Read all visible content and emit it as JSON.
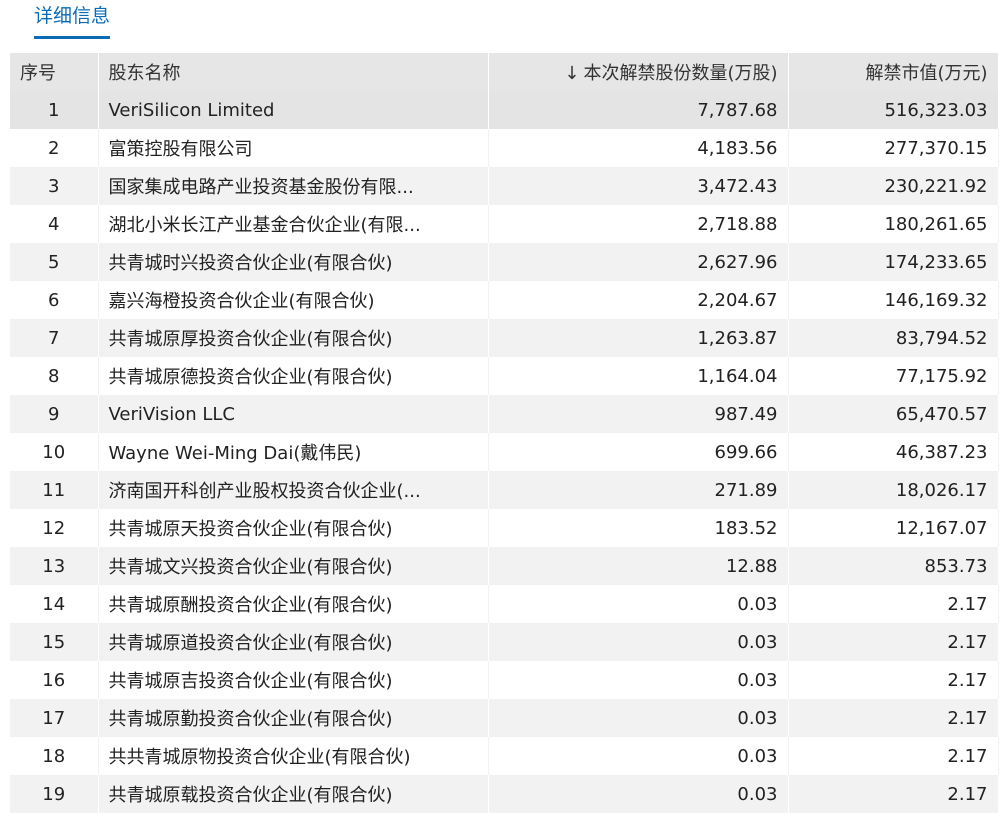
{
  "tabs": {
    "active": "详细信息"
  },
  "table": {
    "headers": {
      "index": "序号",
      "holder": "股东名称",
      "sort_arrow": "↓",
      "shares": "本次解禁股份数量(万股)",
      "value": "解禁市值(万元)"
    },
    "rows": [
      [
        "1",
        "VeriSilicon Limited",
        "7,787.68",
        "516,323.03"
      ],
      [
        "2",
        "富策控股有限公司",
        "4,183.56",
        "277,370.15"
      ],
      [
        "3",
        "国家集成电路产业投资基金股份有限...",
        "3,472.43",
        "230,221.92"
      ],
      [
        "4",
        "湖北小米长江产业基金合伙企业(有限...",
        "2,718.88",
        "180,261.65"
      ],
      [
        "5",
        "共青城时兴投资合伙企业(有限合伙)",
        "2,627.96",
        "174,233.65"
      ],
      [
        "6",
        "嘉兴海橙投资合伙企业(有限合伙)",
        "2,204.67",
        "146,169.32"
      ],
      [
        "7",
        "共青城原厚投资合伙企业(有限合伙)",
        "1,263.87",
        "83,794.52"
      ],
      [
        "8",
        "共青城原德投资合伙企业(有限合伙)",
        "1,164.04",
        "77,175.92"
      ],
      [
        "9",
        "VeriVision LLC",
        "987.49",
        "65,470.57"
      ],
      [
        "10",
        "Wayne Wei-Ming Dai(戴伟民)",
        "699.66",
        "46,387.23"
      ],
      [
        "11",
        "济南国开科创产业股权投资合伙企业(...",
        "271.89",
        "18,026.17"
      ],
      [
        "12",
        "共青城原天投资合伙企业(有限合伙)",
        "183.52",
        "12,167.07"
      ],
      [
        "13",
        "共青城文兴投资合伙企业(有限合伙)",
        "12.88",
        "853.73"
      ],
      [
        "14",
        "共青城原酬投资合伙企业(有限合伙)",
        "0.03",
        "2.17"
      ],
      [
        "15",
        "共青城原道投资合伙企业(有限合伙)",
        "0.03",
        "2.17"
      ],
      [
        "16",
        "共青城原吉投资合伙企业(有限合伙)",
        "0.03",
        "2.17"
      ],
      [
        "17",
        "共青城原勤投资合伙企业(有限合伙)",
        "0.03",
        "2.17"
      ],
      [
        "18",
        "共共青城原物投资合伙企业(有限合伙)",
        "0.03",
        "2.17"
      ],
      [
        "19",
        "共青城原载投资合伙企业(有限合伙)",
        "0.03",
        "2.17"
      ]
    ]
  },
  "colors": {
    "accent": "#0b6cb5",
    "header_bg": "#e6e6e6",
    "row_stripe": "#f2f2f2",
    "row_highlight": "#e4e4e4"
  }
}
